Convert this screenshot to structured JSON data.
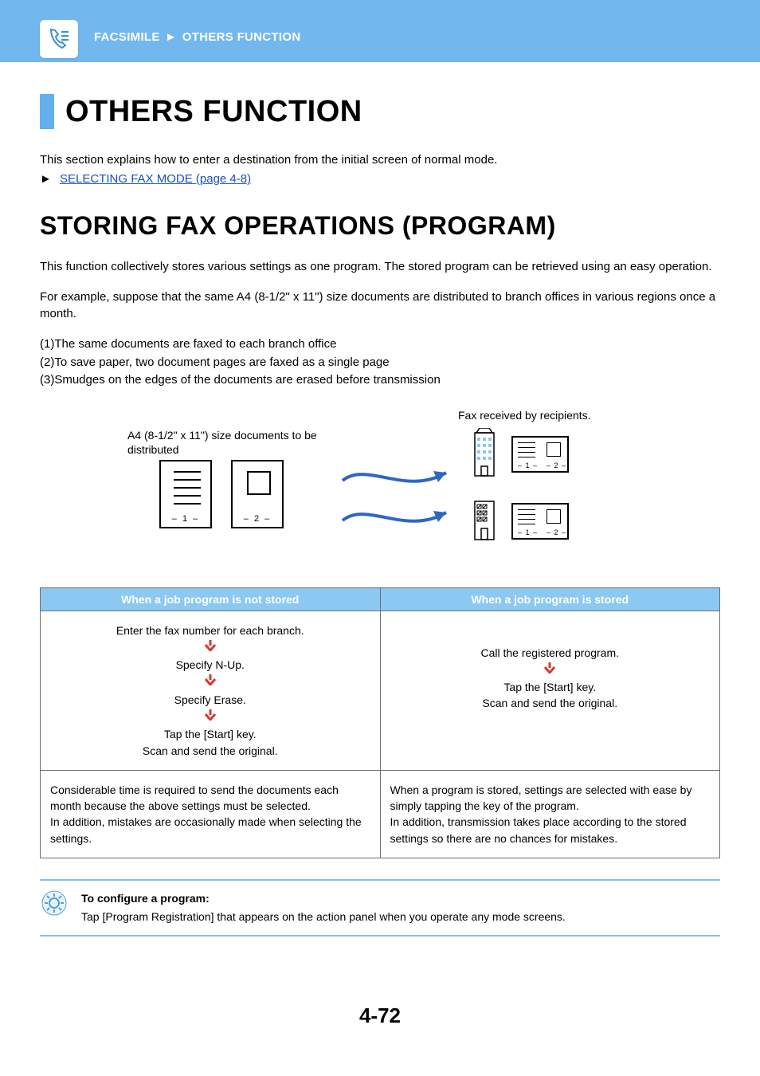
{
  "header": {
    "breadcrumb_1": "FACSIMILE",
    "breadcrumb_2": "OTHERS FUNCTION"
  },
  "h1": "OTHERS FUNCTION",
  "intro": "This section explains how to enter a destination from the initial screen of normal mode.",
  "link": {
    "triangle": "►",
    "text": "SELECTING FAX MODE (page 4-8)"
  },
  "h2": "STORING FAX OPERATIONS (PROGRAM)",
  "para1": "This function collectively stores various settings as one program. The stored program can be retrieved using an easy operation.",
  "para2": "For example, suppose that the same A4 (8-1/2\" x 11\") size documents are distributed to branch offices in various regions once a month.",
  "list": {
    "i1": "(1)The same documents are faxed to each branch office",
    "i2": "(2)To save paper, two document pages are faxed as a single page",
    "i3": "(3)Smudges on the edges of the documents are erased before transmission"
  },
  "diagram": {
    "left_label": "A4 (8-1/2\" x 11\") size documents to be distributed",
    "right_label": "Fax received by recipients.",
    "pg1": "– 1 –",
    "pg2": "– 2 –"
  },
  "table": {
    "th1": "When a job program is not stored",
    "th2": "When a job program is stored",
    "left_flow": {
      "s1": "Enter the fax number for each branch.",
      "s2": "Specify N-Up.",
      "s3": "Specify Erase.",
      "s4": "Tap the [Start] key.",
      "s5": "Scan and send the original."
    },
    "right_flow": {
      "s1": "Call the registered program.",
      "s2": "Tap the [Start] key.",
      "s3": "Scan and send the original."
    },
    "left_desc": "Considerable time is required to send the documents each month because the above settings must be selected.\nIn addition, mistakes are occasionally made when selecting the settings.",
    "right_desc": "When a program is stored, settings are selected with ease by simply tapping the key of the program.\nIn addition, transmission takes place according to the stored settings so there are no chances for mistakes."
  },
  "note": {
    "title": "To configure a program:",
    "body": "Tap [Program Registration] that appears on the action panel when you operate any mode screens."
  },
  "page_number": "4-72"
}
